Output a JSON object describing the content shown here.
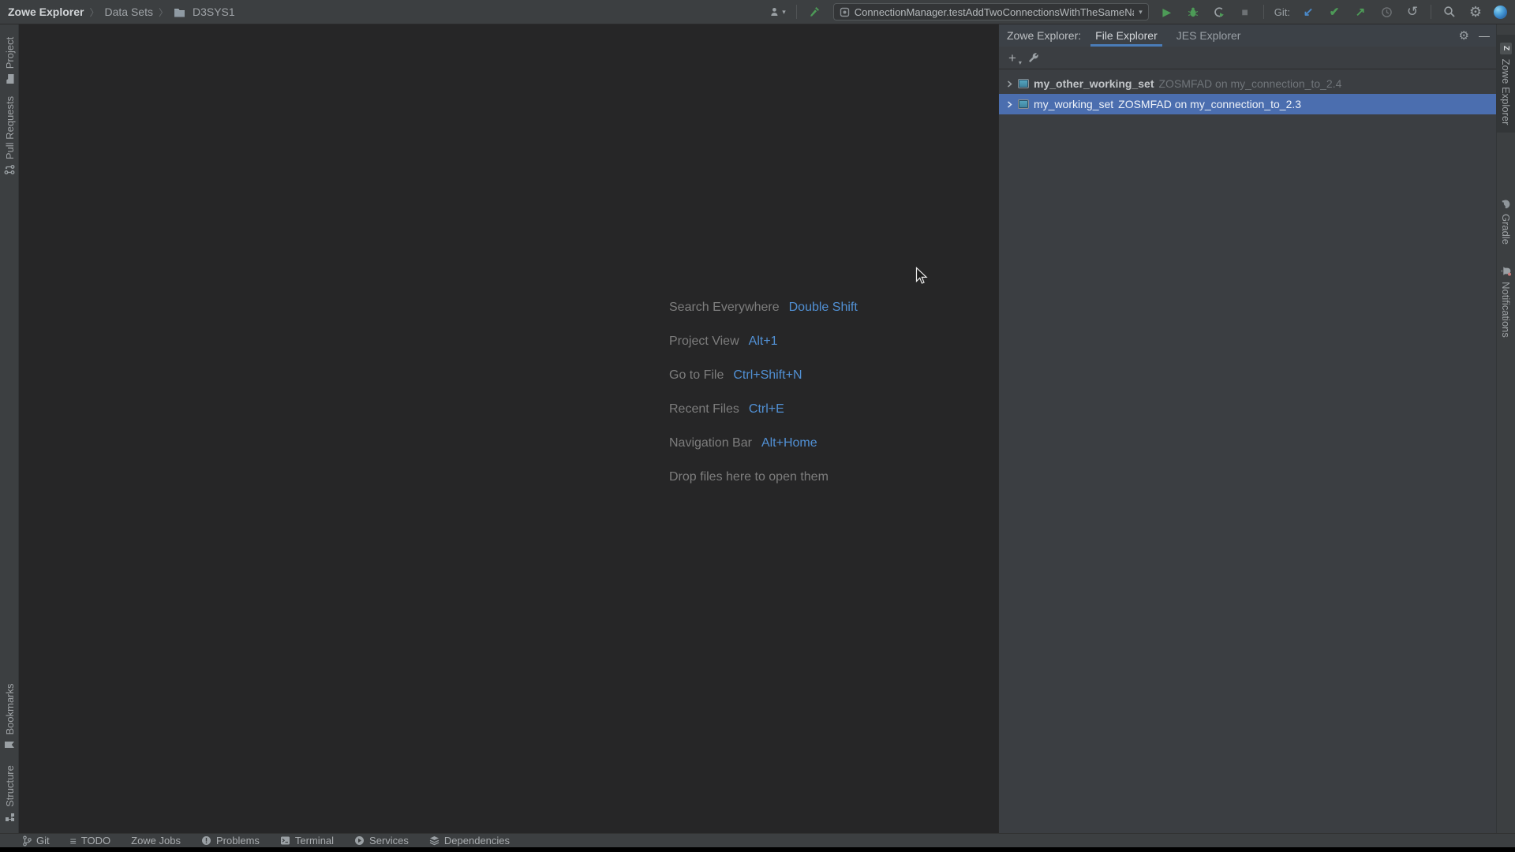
{
  "breadcrumb": {
    "items": [
      "Zowe Explorer",
      "Data Sets",
      "D3SYS1"
    ]
  },
  "toolbar": {
    "run_config": "ConnectionManager.testAddTwoConnectionsWithTheSameName",
    "git_label": "Git:"
  },
  "icons": {
    "caret_down": "▾",
    "plus": "+",
    "minimize": "—",
    "play": "▶",
    "stop": "■",
    "check": "✔",
    "arrow_down_left": "↙",
    "arrow_up_right": "↗",
    "undo": "↺",
    "gear": "⚙",
    "todo_list": "≡",
    "z_logo": "Z"
  },
  "left_stripe": {
    "top": [
      {
        "label": "Project"
      },
      {
        "label": "Pull Requests"
      }
    ],
    "bottom": [
      {
        "label": "Bookmarks"
      },
      {
        "label": "Structure"
      }
    ]
  },
  "right_stripe": {
    "items": [
      {
        "label": "Zowe Explorer"
      },
      {
        "label": "Gradle"
      },
      {
        "label": "Notifications"
      }
    ]
  },
  "editor": {
    "hints": [
      {
        "label": "Search Everywhere",
        "shortcut": "Double Shift"
      },
      {
        "label": "Project View",
        "shortcut": "Alt+1"
      },
      {
        "label": "Go to File",
        "shortcut": "Ctrl+Shift+N"
      },
      {
        "label": "Recent Files",
        "shortcut": "Ctrl+E"
      },
      {
        "label": "Navigation Bar",
        "shortcut": "Alt+Home"
      }
    ],
    "drop_hint": "Drop files here to open them"
  },
  "panel": {
    "title": "Zowe Explorer:",
    "tabs": [
      {
        "label": "File Explorer"
      },
      {
        "label": "JES Explorer"
      }
    ],
    "tree": [
      {
        "name": "my_other_working_set",
        "detail": "ZOSMFAD on my_connection_to_2.4"
      },
      {
        "name": "my_working_set",
        "detail": "ZOSMFAD on my_connection_to_2.3"
      }
    ]
  },
  "status_bar": {
    "items": [
      "Git",
      "TODO",
      "Zowe Jobs",
      "Problems",
      "Terminal",
      "Services",
      "Dependencies"
    ]
  },
  "colors": {
    "selection_blue": "#4b6eaf",
    "tab_underline": "#4a7cb8",
    "shortcut_blue": "#5190d4",
    "run_green": "#4d9b57",
    "git_update_blue": "#4a88c7",
    "editor_bg": "#262627",
    "panel_bg": "#3b3e42",
    "chrome_bg": "#3c3f41"
  }
}
